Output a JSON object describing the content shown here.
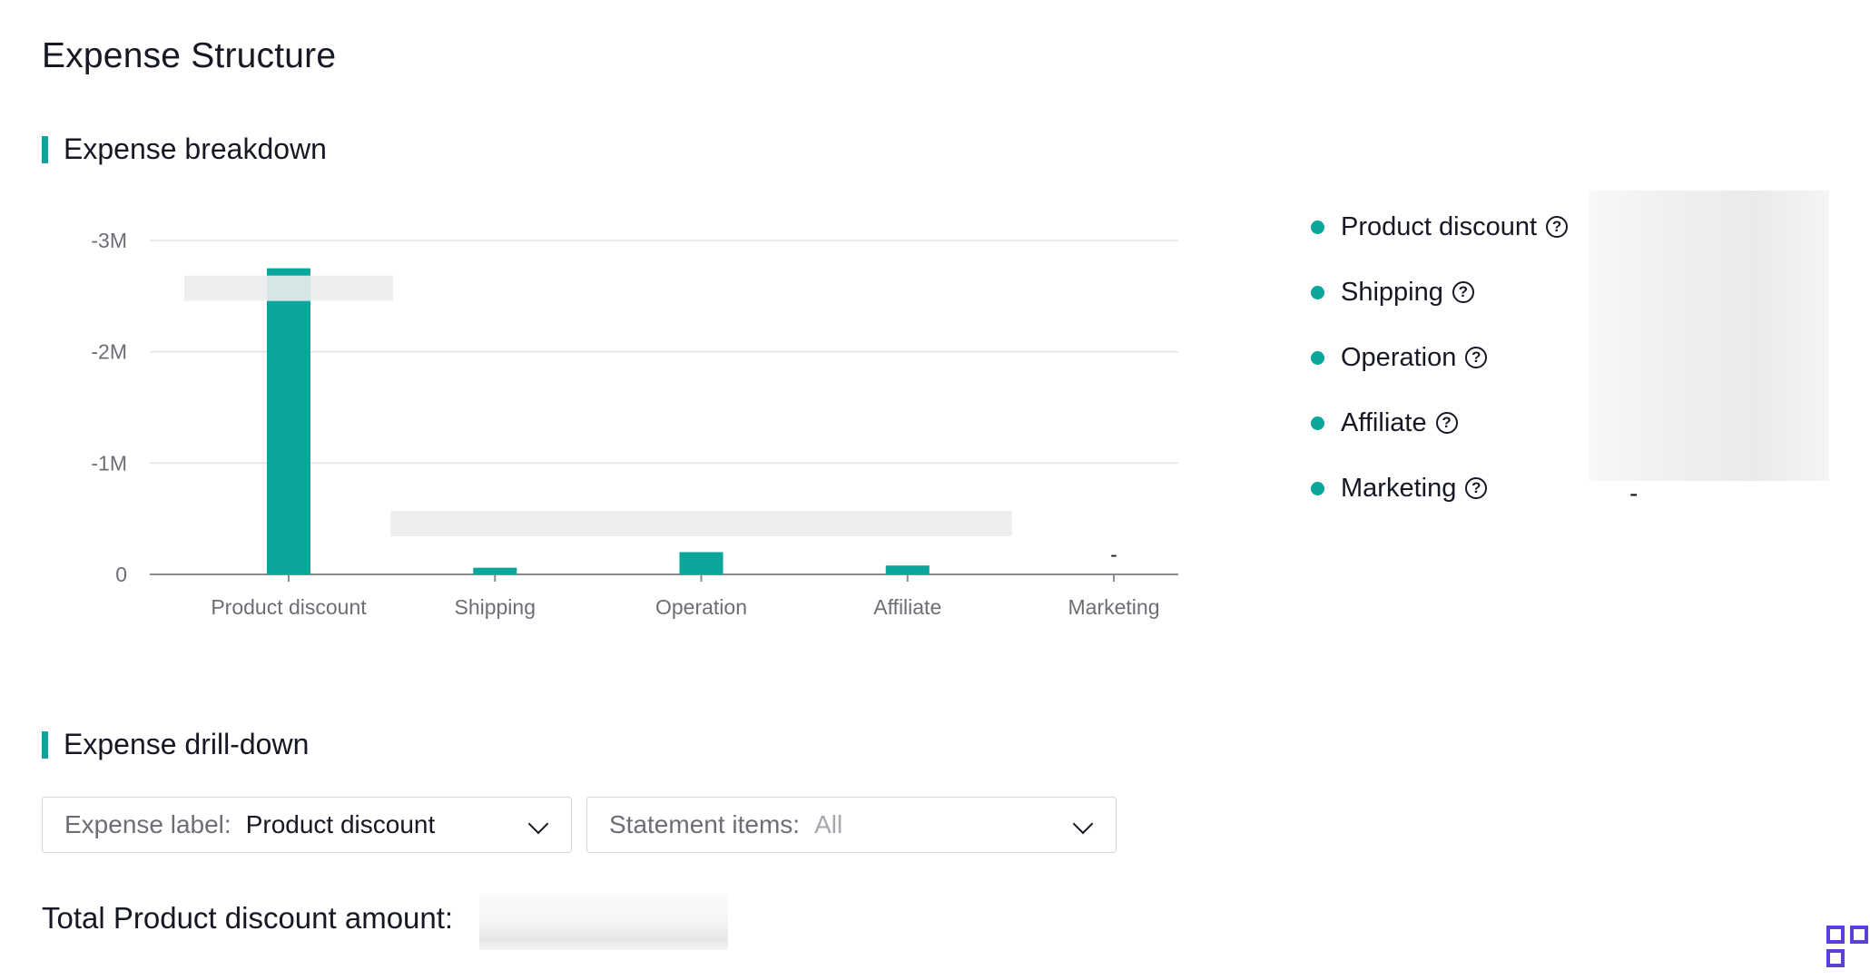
{
  "page": {
    "title": "Expense Structure"
  },
  "sections": {
    "breakdown": {
      "title": "Expense breakdown"
    },
    "drilldown": {
      "title": "Expense drill-down"
    }
  },
  "chart_data": {
    "type": "bar",
    "categories": [
      "Product discount",
      "Shipping",
      "Operation",
      "Affiliate",
      "Marketing"
    ],
    "values": [
      -2.75,
      -0.06,
      -0.2,
      -0.08,
      0
    ],
    "ylim": [
      0,
      -3
    ],
    "y_ticks": [
      "0",
      "-1M",
      "-2M",
      "-3M"
    ],
    "grid": true,
    "bar_color": "#0aa59b",
    "marketing_label": "-"
  },
  "legend": {
    "items": [
      {
        "label": "Product discount"
      },
      {
        "label": "Shipping"
      },
      {
        "label": "Operation"
      },
      {
        "label": "Affiliate"
      },
      {
        "label": "Marketing",
        "value": "-"
      }
    ],
    "help_glyph": "?",
    "dot_color": "#0aa59b"
  },
  "filters": {
    "expense": {
      "label": "Expense label:",
      "value": "Product discount"
    },
    "statement": {
      "label": "Statement items:",
      "value": "All"
    }
  },
  "total": {
    "label": "Total Product discount amount:"
  },
  "icons": {
    "help": "question-circle-icon",
    "chevron": "chevron-down-icon",
    "corner": "qr-code-icon"
  }
}
